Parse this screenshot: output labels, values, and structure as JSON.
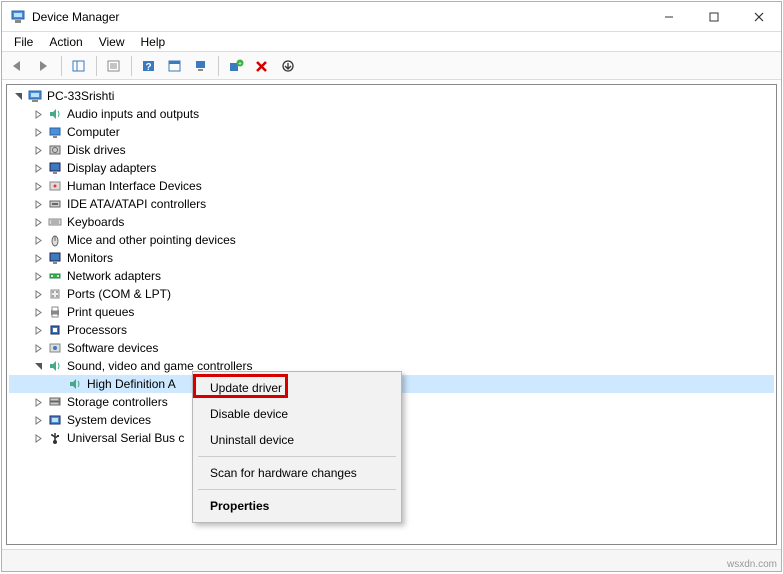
{
  "window": {
    "title": "Device Manager"
  },
  "menubar": {
    "items": [
      "File",
      "Action",
      "View",
      "Help"
    ]
  },
  "toolbar": {
    "back": "back-arrow",
    "forward": "forward-arrow",
    "show_hidden": "show-hidden",
    "properties": "properties",
    "help": "help",
    "action_bar": "action-bar",
    "scan": "scan-hardware",
    "add_legacy": "add-legacy",
    "remove": "remove",
    "update": "update"
  },
  "tree": {
    "root": "PC-33Srishti",
    "categories": [
      {
        "label": "Audio inputs and outputs",
        "icon": "speaker-icon"
      },
      {
        "label": "Computer",
        "icon": "computer-icon"
      },
      {
        "label": "Disk drives",
        "icon": "disk-icon"
      },
      {
        "label": "Display adapters",
        "icon": "display-icon"
      },
      {
        "label": "Human Interface Devices",
        "icon": "hid-icon"
      },
      {
        "label": "IDE ATA/ATAPI controllers",
        "icon": "ide-icon"
      },
      {
        "label": "Keyboards",
        "icon": "keyboard-icon"
      },
      {
        "label": "Mice and other pointing devices",
        "icon": "mouse-icon"
      },
      {
        "label": "Monitors",
        "icon": "monitor-icon"
      },
      {
        "label": "Network adapters",
        "icon": "network-icon"
      },
      {
        "label": "Ports (COM & LPT)",
        "icon": "port-icon"
      },
      {
        "label": "Print queues",
        "icon": "printer-icon"
      },
      {
        "label": "Processors",
        "icon": "cpu-icon"
      },
      {
        "label": "Software devices",
        "icon": "software-icon"
      }
    ],
    "sound_category": {
      "label": "Sound, video and game controllers",
      "icon": "speaker-icon",
      "child": {
        "label": "High Definition A",
        "icon": "speaker-icon"
      }
    },
    "after_categories": [
      {
        "label": "Storage controllers",
        "icon": "storage-icon"
      },
      {
        "label": "System devices",
        "icon": "system-icon"
      },
      {
        "label": "Universal Serial Bus c",
        "icon": "usb-icon"
      }
    ]
  },
  "context_menu": {
    "items": [
      {
        "label": "Update driver"
      },
      {
        "label": "Disable device"
      },
      {
        "label": "Uninstall device"
      }
    ],
    "scan": "Scan for hardware changes",
    "properties": "Properties"
  },
  "watermark": "wsxdn.com"
}
